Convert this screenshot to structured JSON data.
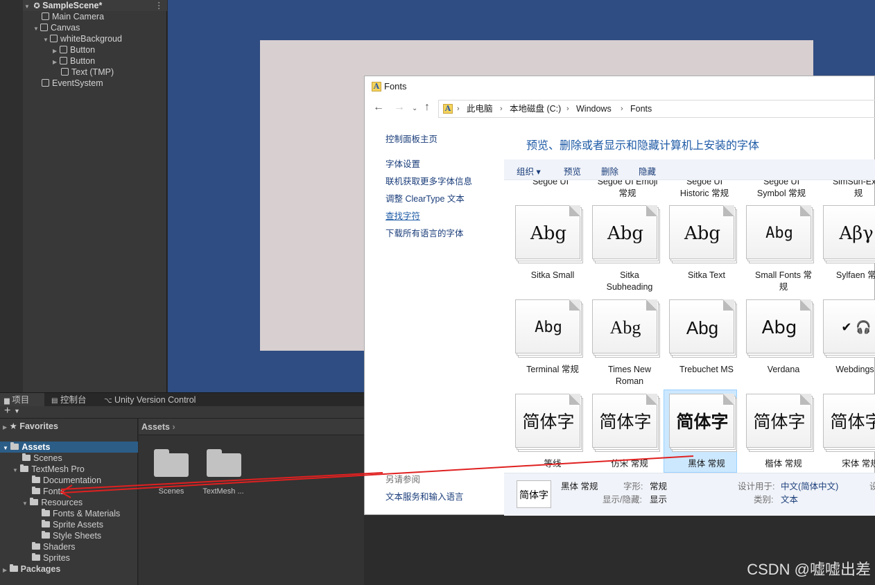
{
  "hierarchy": {
    "scene": "SampleScene*",
    "items": [
      {
        "label": "Main Camera"
      },
      {
        "label": "Canvas"
      },
      {
        "label": "whiteBackgroud"
      },
      {
        "label": "Button"
      },
      {
        "label": "Button"
      },
      {
        "label": "Text (TMP)"
      },
      {
        "label": "EventSystem"
      }
    ]
  },
  "project": {
    "tabs": [
      "项目",
      "控制台",
      "Unity Version Control"
    ],
    "favorites": "Favorites",
    "tree": [
      {
        "label": "Assets"
      },
      {
        "label": "Scenes"
      },
      {
        "label": "TextMesh Pro"
      },
      {
        "label": "Documentation"
      },
      {
        "label": "Fonts"
      },
      {
        "label": "Resources"
      },
      {
        "label": "Fonts & Materials"
      },
      {
        "label": "Sprite Assets"
      },
      {
        "label": "Style Sheets"
      },
      {
        "label": "Shaders"
      },
      {
        "label": "Sprites"
      },
      {
        "label": "Packages"
      }
    ],
    "breadcrumb": "Assets",
    "content": [
      {
        "label": "Scenes"
      },
      {
        "label": "TextMesh ..."
      }
    ]
  },
  "fonts_window": {
    "title": "Fonts",
    "address": [
      "此电脑",
      "本地磁盘 (C:)",
      "Windows",
      "Fonts"
    ],
    "left_links": [
      "控制面板主页",
      "字体设置",
      "联机获取更多字体信息",
      "调整 ClearType 文本",
      "查找字符",
      "下载所有语言的字体"
    ],
    "see_also": "另请参阅",
    "bottom_link": "文本服务和输入语言",
    "heading": "预览、删除或者显示和隐藏计算机上安装的字体",
    "toolbar": [
      "组织 ▾",
      "预览",
      "删除",
      "隐藏"
    ],
    "partial_row": [
      "Segoe UI",
      "Segoe UI Emoji\n常规",
      "Segoe UI\nHistoric 常规",
      "Segoe UI\nSymbol 常规",
      "SimSun-ExtB\n规"
    ],
    "fonts": [
      {
        "sample": "Abg",
        "name": "Sitka Small"
      },
      {
        "sample": "Abg",
        "name": "Sitka\nSubheading"
      },
      {
        "sample": "Abg",
        "name": "Sitka Text"
      },
      {
        "sample": "Abg",
        "name": "Small Fonts 常\n规"
      },
      {
        "sample": "Αβγ",
        "name": "Sylfaen 常规"
      },
      {
        "sample": "Abg",
        "name": "Terminal 常规"
      },
      {
        "sample": "Abg",
        "name": "Times New\nRoman"
      },
      {
        "sample": "Abg",
        "name": "Trebuchet MS"
      },
      {
        "sample": "Abg",
        "name": "Verdana"
      },
      {
        "sample": "✔ 🎧",
        "name": "Webdings 常"
      },
      {
        "sample": "简体字",
        "name": "等线"
      },
      {
        "sample": "简体字",
        "name": "仿宋 常规"
      },
      {
        "sample": "简体字",
        "name": "黑体 常规"
      },
      {
        "sample": "简体字",
        "name": "楷体 常规"
      },
      {
        "sample": "简体字",
        "name": "宋体 常规"
      }
    ],
    "details": {
      "preview": "简体字",
      "name": "黑体 常规",
      "style_label": "字形:",
      "style": "常规",
      "show_label": "显示/隐藏:",
      "show": "显示",
      "designed_label": "设计用于:",
      "designed": "中文(简体中文)",
      "category_label": "类别:",
      "category": "文本",
      "cut": "设"
    }
  },
  "watermark": "CSDN @嘘嘘出差",
  "colors": {
    "scene_bg": "#2f4d82",
    "canvas": "#d8cfd0",
    "selection": "#2c5d87",
    "arrow": "#e02020",
    "link": "#1a3d7a",
    "heading": "#1e5aa6"
  }
}
